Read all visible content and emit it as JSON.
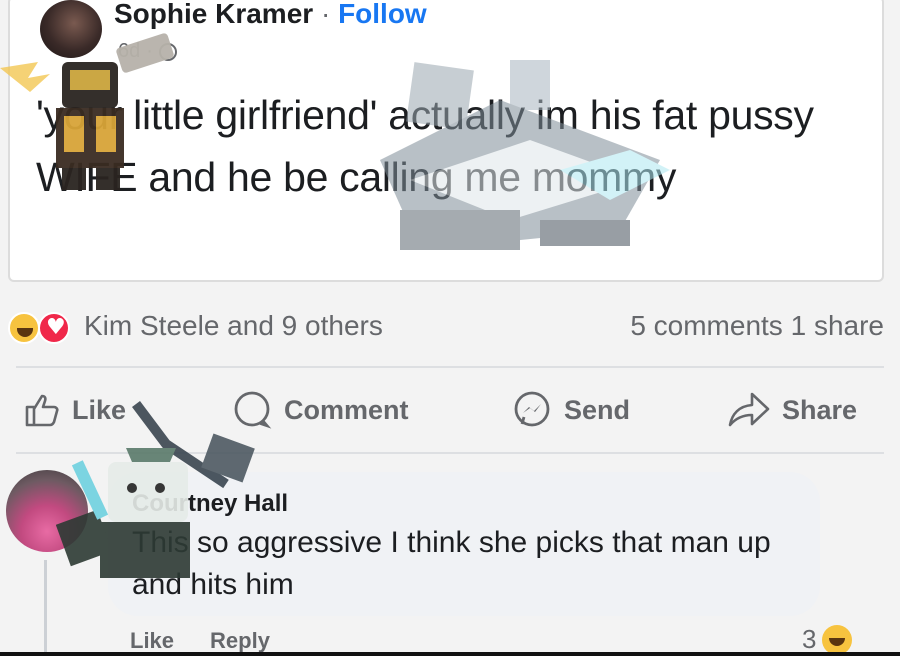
{
  "post": {
    "author_name": "Sophie Kramer",
    "separator": "·",
    "follow_label": "Follow",
    "timestamp": "6d",
    "text": "'your little girlfriend' actually im his fat pussy WIFE and he be calling me mommy"
  },
  "reactions": {
    "icons": [
      "haha-icon",
      "love-icon"
    ],
    "reactors_text": "Kim Steele and 9 others",
    "comments_text": "5 comments",
    "shares_text": "1 share"
  },
  "actions": {
    "like_label": "Like",
    "comment_label": "Comment",
    "send_label": "Send",
    "share_label": "Share"
  },
  "comment": {
    "author_name": "Courtney Hall",
    "text": "This so aggressive I think she picks that man up and hits him",
    "like_label": "Like",
    "reply_label": "Reply",
    "reaction_count": "3",
    "reaction_icon": "haha-icon"
  },
  "colors": {
    "link_blue": "#1877f2",
    "muted_text": "#65676b",
    "bubble_bg": "#f0f2f5",
    "love_red": "#f0284a",
    "haha_yellow": "#f7c33f"
  }
}
